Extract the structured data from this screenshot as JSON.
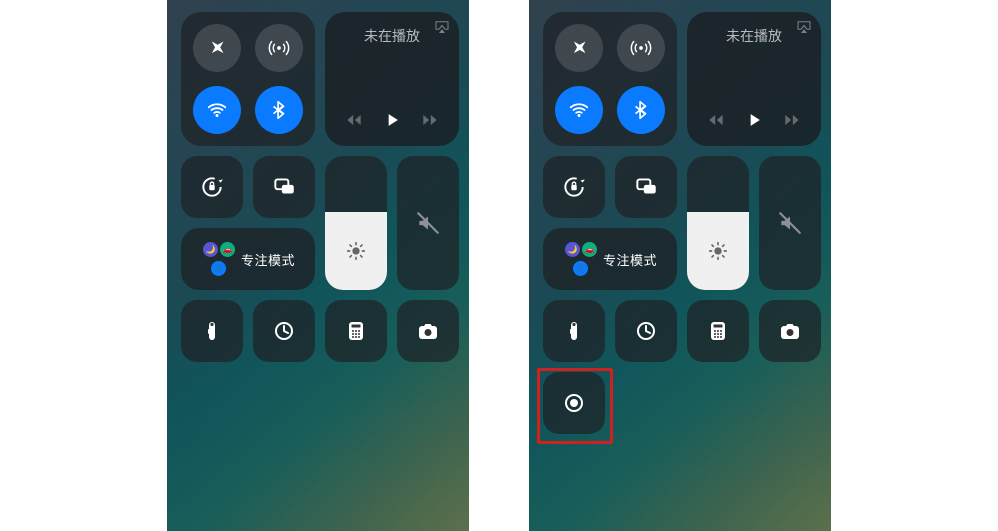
{
  "media": {
    "now_playing_label": "未在播放"
  },
  "focus": {
    "label": "专注模式"
  },
  "icons": {
    "airplane": "airplane",
    "cellular": "cellular",
    "wifi": "wifi",
    "bluetooth": "bluetooth",
    "airplay": "airplay",
    "prev": "prev",
    "play": "play",
    "next": "next",
    "lock_rotation": "lock-rotation",
    "mirroring": "mirroring",
    "brightness": "brightness",
    "mute": "mute",
    "flashlight": "flashlight",
    "timer": "timer",
    "calculator": "calculator",
    "camera": "camera",
    "screen_record": "screen-record"
  },
  "connectivity": {
    "airplane_active": false,
    "cellular_active": false,
    "wifi_active": true,
    "bluetooth_active": true
  },
  "brightness": {
    "value_percent": 58
  },
  "panels": {
    "left_has_screen_record": false,
    "right_has_screen_record": true,
    "right_highlight_screen_record": true
  },
  "colors": {
    "active_blue": "#0a7bff",
    "highlight_red": "#d02020"
  }
}
